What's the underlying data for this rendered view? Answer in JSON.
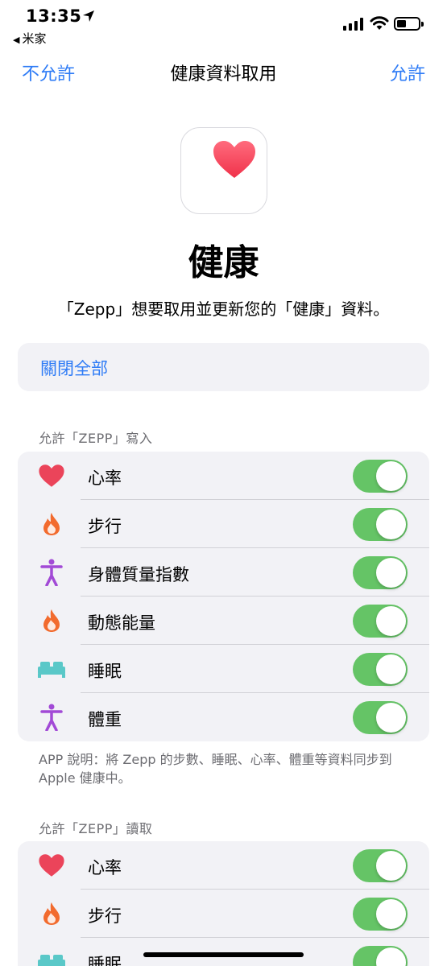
{
  "status_bar": {
    "time": "13:35",
    "back_app": "米家",
    "icons": [
      "location-arrow-icon",
      "cellular-signal-icon",
      "wifi-icon",
      "battery-icon"
    ]
  },
  "nav": {
    "left": "不允許",
    "title": "健康資料取用",
    "right": "允許"
  },
  "app": {
    "icon": "heart-icon",
    "name": "健康",
    "description": "「Zepp」想要取用並更新您的「健康」資料。"
  },
  "turn_off_all": "關閉全部",
  "write_section": {
    "header": "允許「ZEPP」寫入",
    "items": [
      {
        "label": "心率",
        "icon": "heart-icon",
        "enabled": true
      },
      {
        "label": "步行",
        "icon": "flame-icon",
        "enabled": true
      },
      {
        "label": "身體質量指數",
        "icon": "body-figure-icon",
        "enabled": true
      },
      {
        "label": "動態能量",
        "icon": "flame-icon",
        "enabled": true
      },
      {
        "label": "睡眠",
        "icon": "bed-icon",
        "enabled": true
      },
      {
        "label": "體重",
        "icon": "body-figure-icon",
        "enabled": true
      }
    ],
    "footer": "APP 說明：將 Zepp 的步數、睡眠、心率、體重等資料同步到 Apple 健康中。"
  },
  "read_section": {
    "header": "允許「ZEPP」讀取",
    "items": [
      {
        "label": "心率",
        "icon": "heart-icon",
        "enabled": true
      },
      {
        "label": "步行",
        "icon": "flame-icon",
        "enabled": true
      },
      {
        "label": "睡眠",
        "icon": "bed-icon",
        "enabled": true
      }
    ]
  },
  "colors": {
    "accent": "#2f7cf6",
    "toggle_on": "#65c466",
    "heart": "#eb445a",
    "flame": "#f26b2e",
    "body": "#a24ad6",
    "bed": "#5ac8c8"
  }
}
